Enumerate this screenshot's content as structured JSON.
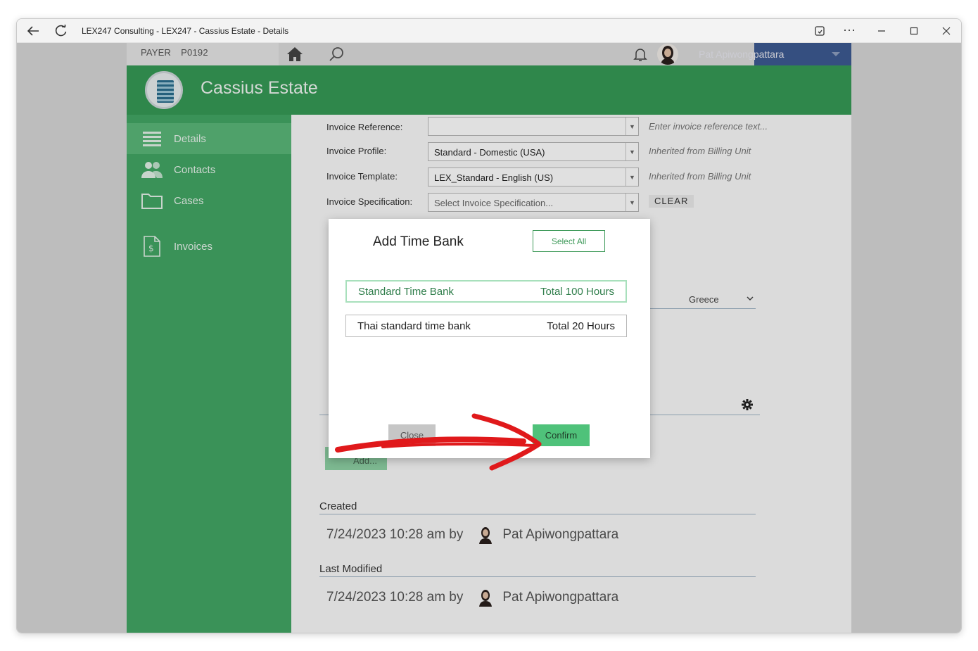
{
  "window": {
    "title": "LEX247 Consulting - LEX247 - Cassius Estate - Details"
  },
  "topbar": {
    "payer_label": "PAYER",
    "payer_code": "P0192",
    "user_name": "Pat Apiwongpattara"
  },
  "header": {
    "title": "Cassius Estate"
  },
  "sidebar": {
    "items": [
      {
        "label": "Details",
        "icon": "list-icon"
      },
      {
        "label": "Contacts",
        "icon": "contacts-icon"
      },
      {
        "label": "Cases",
        "icon": "folder-icon"
      },
      {
        "label": "Invoices",
        "icon": "invoice-icon"
      }
    ]
  },
  "form": {
    "invoice_reference": {
      "label": "Invoice Reference:",
      "value": "",
      "hint": "Enter invoice reference text..."
    },
    "invoice_profile": {
      "label": "Invoice Profile:",
      "value": "Standard - Domestic (USA)",
      "hint": "Inherited from Billing Unit"
    },
    "invoice_template": {
      "label": "Invoice Template:",
      "value": "LEX_Standard - English (US)",
      "hint": "Inherited from Billing Unit"
    },
    "invoice_specification": {
      "label": "Invoice Specification:",
      "placeholder": "Select Invoice Specification...",
      "clear_label": "CLEAR"
    },
    "country_value": "Greece",
    "add_label": "Add..."
  },
  "audit": {
    "created_label": "Created",
    "created_value": "7/24/2023 10:28 am by",
    "created_user": "Pat Apiwongpattara",
    "modified_label": "Last Modified",
    "modified_value": "7/24/2023 10:28 am by",
    "modified_user": "Pat Apiwongpattara"
  },
  "modal": {
    "title": "Add Time Bank",
    "select_all_label": "Select All",
    "time_banks": [
      {
        "name": "Standard Time Bank",
        "total": "Total 100 Hours",
        "selected": true
      },
      {
        "name": "Thai standard time bank",
        "total": "Total 20 Hours",
        "selected": false
      }
    ],
    "close_label": "Close",
    "confirm_label": "Confirm"
  },
  "colors": {
    "header_green": "#369a56",
    "sidebar_green": "#43a765",
    "confirm_green": "#4fc27a",
    "annotation_red": "#e0191b"
  }
}
